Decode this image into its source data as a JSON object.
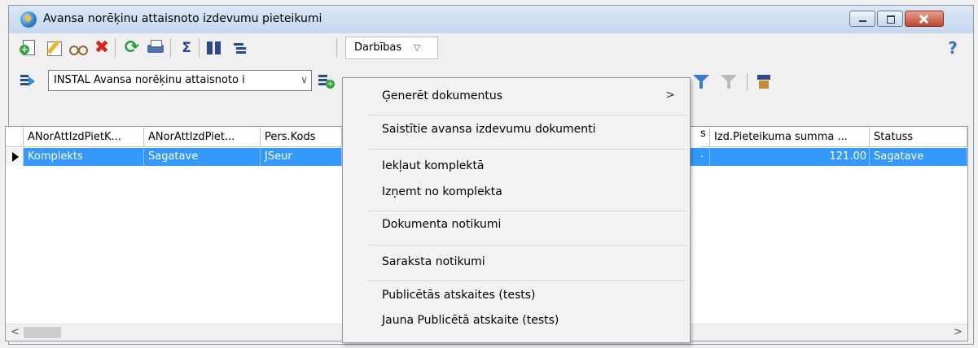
{
  "window": {
    "title": "Avansa norēķinu attaisnoto izdevumu pieteikumi"
  },
  "toolbar": {
    "actions_label": "Darbības",
    "actions_arrow": "▽",
    "help_icon": "?"
  },
  "filter": {
    "combo_value": "INSTAL Avansa norēķinu attaisnoto i",
    "combo_arrow": "∨"
  },
  "grid": {
    "columns": [
      "ANorAttIzdPietK...",
      "ANorAttIzdPiet...",
      "Pers.Kods",
      "s",
      "Izd.Pieteikuma summa ...",
      "Statuss"
    ],
    "rows": [
      {
        "c1": "Komplekts",
        "c2": "Sagatave",
        "c3": "JSeur",
        "c8": ".",
        "c9": "121.00",
        "c10": "Sagatave"
      }
    ],
    "scroll_left": "<",
    "scroll_right": ">"
  },
  "menu": {
    "items": [
      {
        "label": "Ģenerēt dokumentus",
        "submenu": ">"
      },
      {
        "label": "Saistītie avansa izdevumu dokumenti"
      },
      {
        "label": "Iekļaut komplektā"
      },
      {
        "label": "Izņemt no komplekta"
      },
      {
        "label": "Dokumenta notikumi"
      },
      {
        "label": "Saraksta notikumi"
      },
      {
        "label": "Publicētās atskaites (tests)"
      },
      {
        "label": "Jauna Publicētā atskaite (tests)"
      }
    ]
  },
  "colors": {
    "selection": "#3399ff",
    "titlebar": "#c4d8ee",
    "close_button": "#c0452c"
  },
  "icons": [
    "new-document-icon",
    "edit-icon",
    "view-icon",
    "delete-icon",
    "refresh-icon",
    "print-icon",
    "sum-icon",
    "columns-icon",
    "tree-icon",
    "help-icon",
    "filter-list-icon",
    "add-filter-icon",
    "funnel-icon",
    "funnel-disabled-icon",
    "clear-filter-icon"
  ]
}
